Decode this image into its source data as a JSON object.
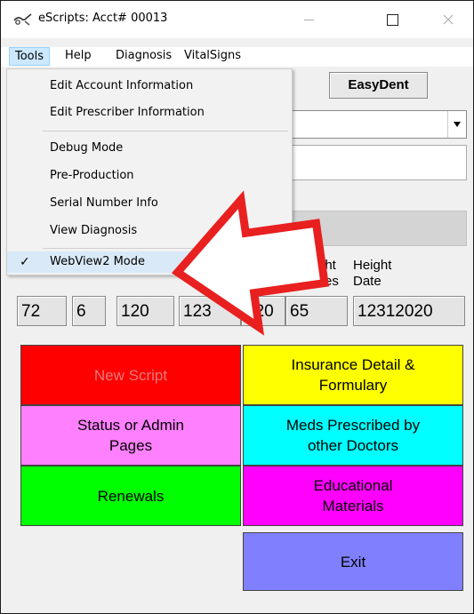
{
  "window": {
    "title": "eScripts: Acct# 00013",
    "app_icon": "prescription-pen-icon",
    "controls": {
      "minimize": "minimize-icon",
      "maximize": "maximize-icon",
      "close": "close-icon"
    }
  },
  "menubar": {
    "items": [
      "Tools",
      "Help",
      "Diagnosis",
      "VitalSigns"
    ],
    "active": "Tools"
  },
  "tools_menu": {
    "groups": [
      [
        "Edit Account Information",
        "Edit Prescriber Information"
      ],
      [
        "Debug Mode",
        "Pre-Production",
        "Serial Number Info",
        "View Diagnosis"
      ],
      [
        "WebView2 Mode"
      ]
    ],
    "checked_item": "WebView2 Mode",
    "check_icon": "checkmark-icon"
  },
  "form": {
    "brand_button": "EasyDent",
    "labels": {
      "weight_partial": "ght",
      "weight_partial_2": "es",
      "height": "Height",
      "height_date": "Date"
    },
    "vitals": [
      "72",
      "6",
      "120",
      "123",
      "020",
      "65",
      "12312020"
    ]
  },
  "buttons": {
    "new_script": "New Script",
    "insurance_line1": "Insurance Detail &",
    "insurance_line2": "Formulary",
    "status_line1": "Status or Admin",
    "status_line2": "Pages",
    "meds_line1": "Meds Prescribed by",
    "meds_line2": "other Doctors",
    "renewals": "Renewals",
    "edu_line1": "Educational",
    "edu_line2": "Materials",
    "exit": "Exit"
  },
  "annotation": {
    "arrow_color": "#e8201f",
    "arrow_icon": "red-arrow-icon"
  },
  "colors": {
    "new_script": "#ff0000",
    "insurance": "#ffff00",
    "status": "#ff80ff",
    "meds": "#00ffff",
    "renewals": "#00ff00",
    "educational": "#ff00ff",
    "exit": "#8080ff"
  }
}
